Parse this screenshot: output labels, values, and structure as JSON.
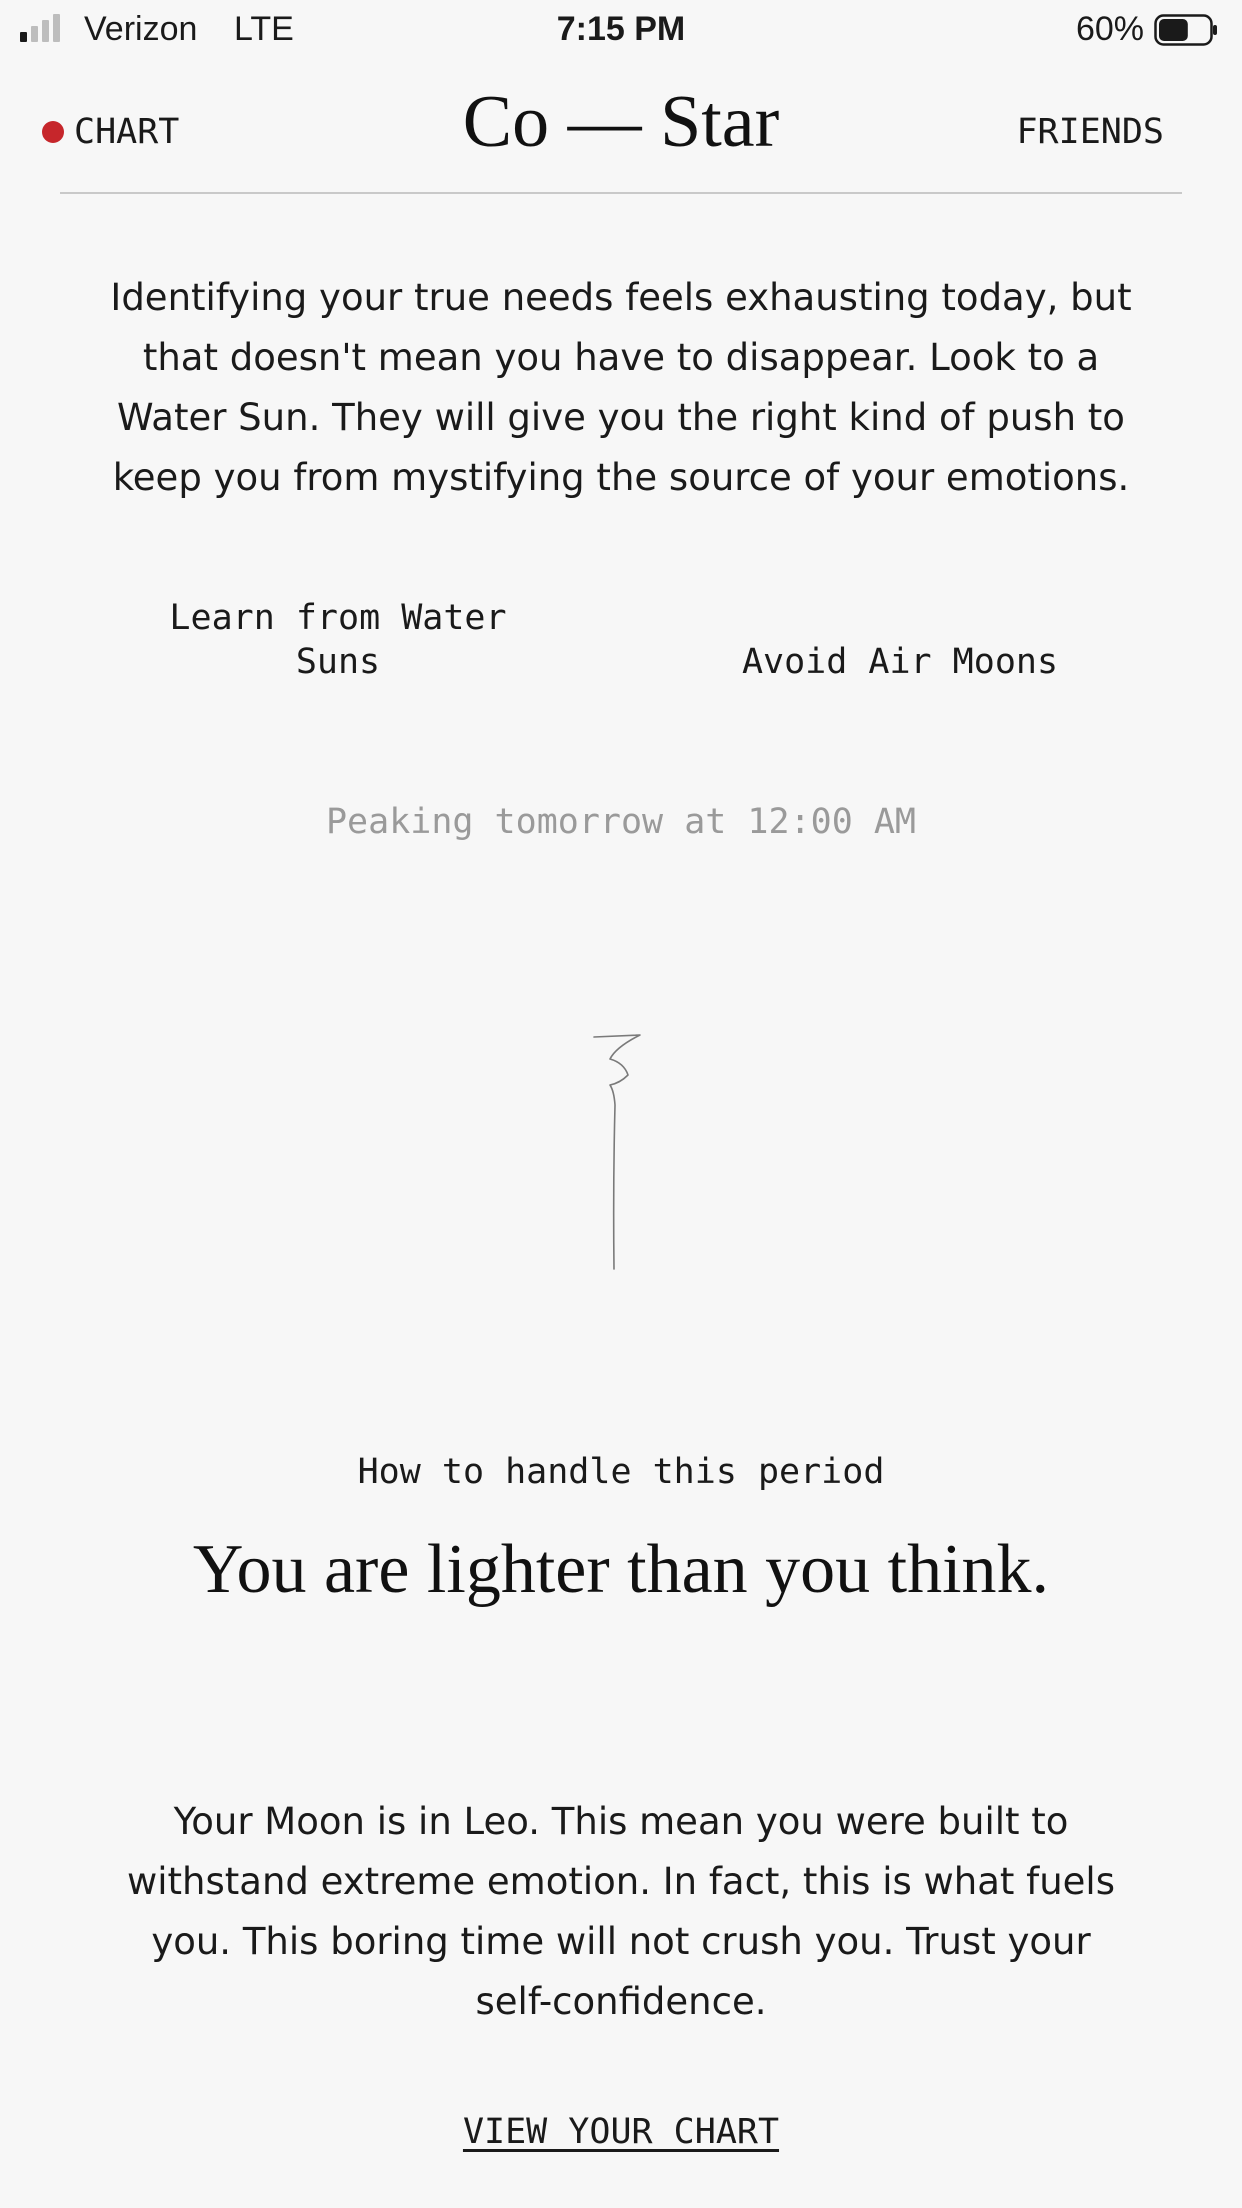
{
  "status_bar": {
    "carrier": "Verizon",
    "network": "LTE",
    "time": "7:15 PM",
    "battery_percent": "60%",
    "battery_level": 0.6,
    "signal_bars_active": 1
  },
  "header": {
    "chart_label": "CHART",
    "logo": "Co — Star",
    "friends_label": "FRIENDS",
    "accent_color": "#c6262b"
  },
  "daily": {
    "intro": "Identifying your true needs feels exhausting today, but that doesn't mean you have to disappear. Look to a Water Sun. They will give you the right kind of push to keep you from mystifying the source of your emotions.",
    "do": "Learn from Water Suns",
    "dont": "Avoid Air Moons",
    "peaking": "Peaking tomorrow at 12:00 AM"
  },
  "period": {
    "label": "How to handle this period",
    "headline": "You are lighter than you think.",
    "body": "Your Moon is in Leo. This mean you were built to withstand extreme emotion. In fact, this is what fuels you. This boring time will not crush you. Trust your self-confidence."
  },
  "actions": {
    "view_chart": "VIEW YOUR CHART"
  }
}
